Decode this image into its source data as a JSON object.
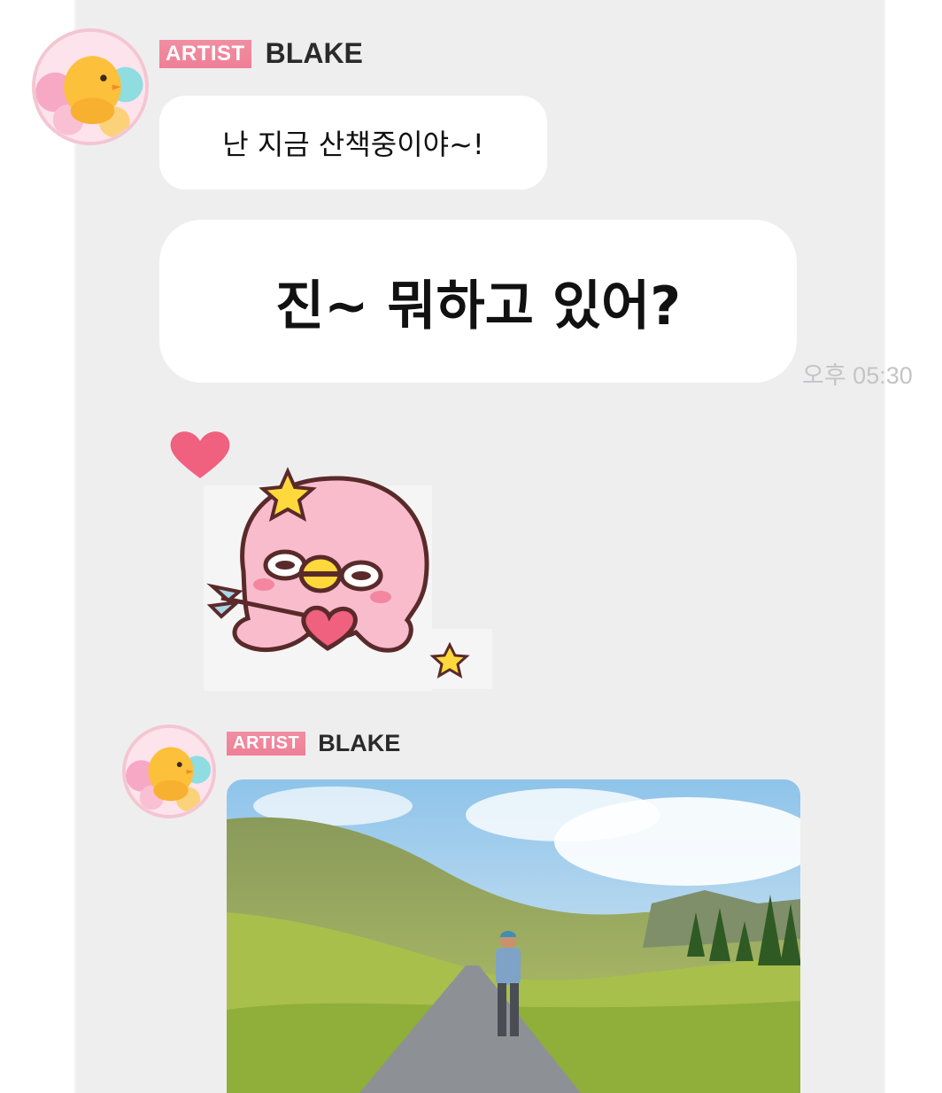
{
  "messages": [
    {
      "badge": "ARTIST",
      "sender": "BLAKE",
      "text_small": "난 지금 산책중이야~!",
      "text_large": "진~ 뭐하고 있어?",
      "time": "오후 05:30"
    },
    {
      "badge": "ARTIST",
      "sender": "BLAKE"
    }
  ],
  "icons": {
    "avatar": "chick-balloon-avatar-icon",
    "sticker": "pink-octopus-heart-arrow-sticker",
    "photo": "man-on-country-road-photo"
  },
  "colors": {
    "badge": "#ef7f96",
    "chat_bg": "#efeeef",
    "bubble": "#ffffff",
    "heart": "#f0607f"
  }
}
